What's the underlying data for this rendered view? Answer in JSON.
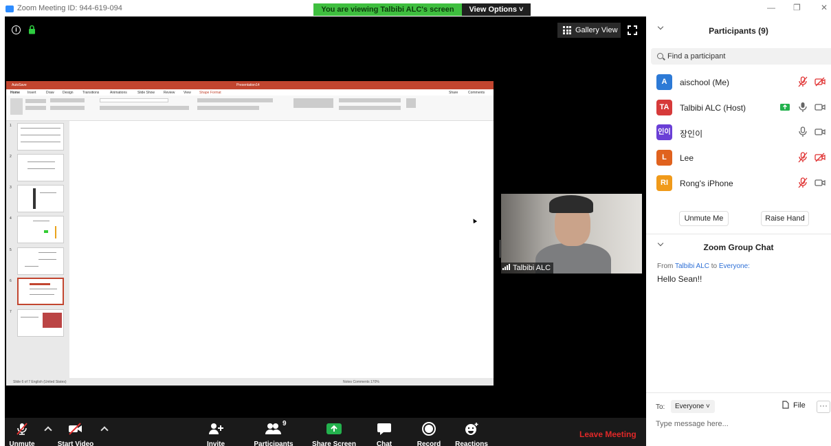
{
  "window": {
    "title": "Zoom Meeting ID: 944-619-094",
    "viewing_banner": "You are viewing Talbibi ALC's screen",
    "view_options": "View Options ˅",
    "gallery_view": "Gallery View",
    "controls": {
      "minimize": "—",
      "restore": "❐",
      "close": "✕"
    }
  },
  "shared_screen": {
    "app_title": "Presentation14",
    "autosave": "AutoSave",
    "tabs": [
      "Home",
      "Insert",
      "Draw",
      "Design",
      "Transitions",
      "Animations",
      "Slide Show",
      "Review",
      "View",
      "Shape Format"
    ],
    "share": "Share",
    "comments": "Comments",
    "thumbnail_numbers": [
      "1",
      "2",
      "3",
      "4",
      "5",
      "6",
      "7"
    ],
    "status_left": "Slide 6 of 7   English (United States)",
    "status_right": "Notes   Comments          170%"
  },
  "video_tile": {
    "name": "Talbibi ALC"
  },
  "toolbar": {
    "unmute": "Unmute",
    "start_video": "Start Video",
    "invite": "Invite",
    "participants": "Participants",
    "participants_count": "9",
    "share_screen": "Share Screen",
    "chat": "Chat",
    "record": "Record",
    "reactions": "Reactions",
    "leave": "Leave Meeting"
  },
  "participants_panel": {
    "title": "Participants (9)",
    "search_placeholder": "Find a participant",
    "people": [
      {
        "initials": "A",
        "name": "aischool (Me)",
        "color": "#2d7ad6"
      },
      {
        "initials": "TA",
        "name": "Talbibi ALC (Host)",
        "color": "#d63a3a"
      },
      {
        "initials": "인이",
        "name": "장인이",
        "color": "#6a3fd6"
      },
      {
        "initials": "L",
        "name": "Lee",
        "color": "#e0621e"
      },
      {
        "initials": "RI",
        "name": "Rong's iPhone",
        "color": "#f09a1a"
      }
    ],
    "unmute_me": "Unmute Me",
    "raise_hand": "Raise Hand"
  },
  "chat": {
    "title": "Zoom Group Chat",
    "from_label": "From",
    "from": "Talbibi ALC",
    "to_label": "to",
    "to": "Everyone:",
    "message": "Hello Sean!!",
    "to_prefix": "To:",
    "recipient": "Everyone ˅",
    "file": "File",
    "more": "···",
    "input_placeholder": "Type message here..."
  },
  "colors": {
    "accent": "#2d8cff",
    "leave": "#e02828",
    "banner": "#3fbf3f",
    "muted_red": "#e03030"
  }
}
